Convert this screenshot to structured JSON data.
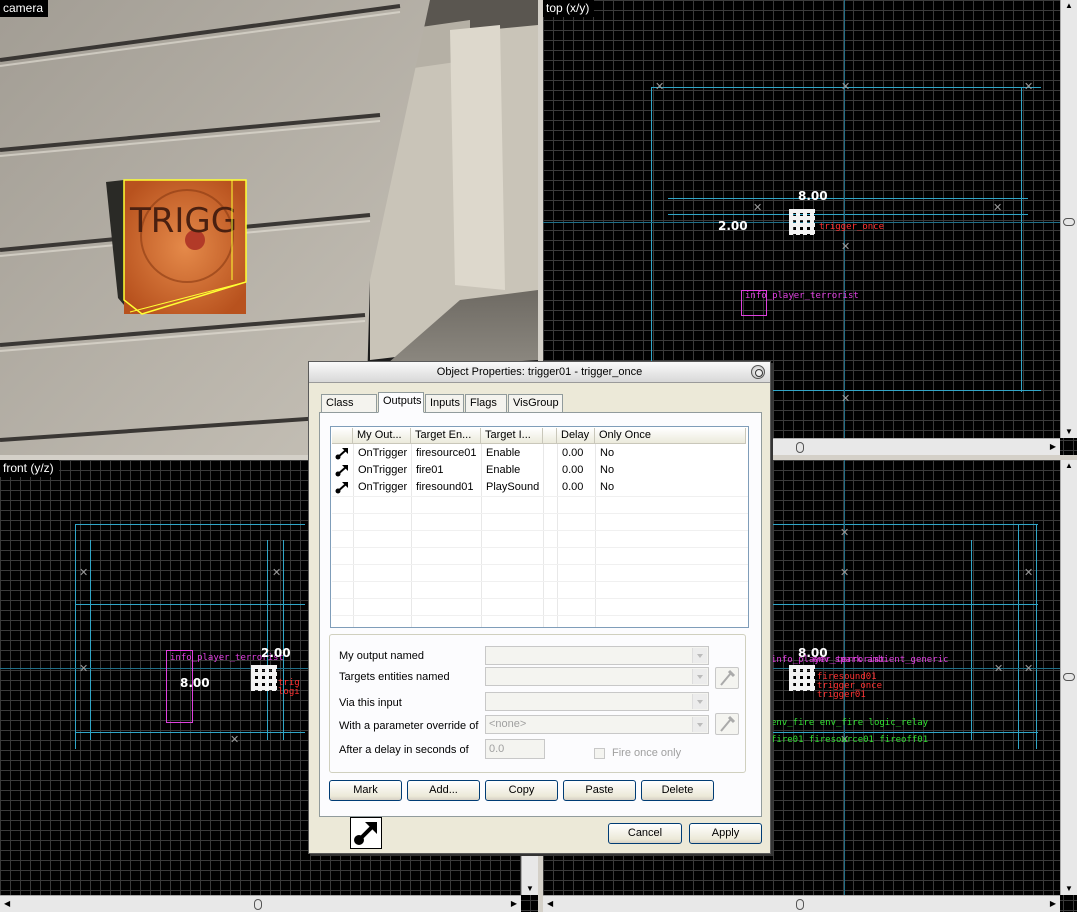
{
  "viewports": {
    "camera": {
      "label": "camera",
      "sign_text": "TRIGG"
    },
    "top": {
      "label": "top (x/y)",
      "dim_w": "8.00",
      "dim_h": "2.00",
      "ent_label_1": "trigger_once",
      "ent_label_2": "info_player_terrorist"
    },
    "front": {
      "label": "front (y/z)",
      "dim_w": "2.00",
      "dim_h": "8.00",
      "ent_label_1": "info_player_terrorist",
      "ent_label_2": "trig",
      "ent_label_3": "logi"
    },
    "side": {
      "label": "",
      "dim_w": "8.00",
      "ent_label_1": "info_player_terrorist",
      "ent_label_2": "env_spark ambient_generic",
      "ent_label_3": "firesound01",
      "ent_label_4": "trigger_once",
      "ent_label_5": "trigger01",
      "ent_label_6": "env_fire env_fire logic_relay",
      "ent_label_7": "fire01 firesource01 fireoff01"
    }
  },
  "dialog": {
    "title": "Object Properties: trigger01 - trigger_once",
    "tabs": [
      {
        "label": "Class Info",
        "active": false
      },
      {
        "label": "Outputs",
        "active": true
      },
      {
        "label": "Inputs",
        "active": false
      },
      {
        "label": "Flags",
        "active": false
      },
      {
        "label": "VisGroup",
        "active": false
      }
    ],
    "table": {
      "headers": [
        "My Out...",
        "Target En...",
        "Target I...",
        "Delay",
        "Only Once"
      ],
      "rows": [
        {
          "output": "OnTrigger",
          "target": "firesource01",
          "input": "Enable",
          "delay": "0.00",
          "once": "No"
        },
        {
          "output": "OnTrigger",
          "target": "fire01",
          "input": "Enable",
          "delay": "0.00",
          "once": "No"
        },
        {
          "output": "OnTrigger",
          "target": "firesound01",
          "input": "PlaySound",
          "delay": "0.00",
          "once": "No"
        }
      ]
    },
    "form": {
      "output_label": "My output named",
      "targets_label": "Targets entities named",
      "input_label": "Via this input",
      "param_label": "With a parameter override of",
      "param_value": "<none>",
      "delay_label": "After a delay in seconds of",
      "delay_value": "0.0",
      "fire_once_label": "Fire once only"
    },
    "buttons": {
      "mark": "Mark",
      "add": "Add...",
      "copy": "Copy",
      "paste": "Paste",
      "delete": "Delete",
      "cancel": "Cancel",
      "apply": "Apply"
    }
  },
  "colors": {
    "grid_line": "#2fa6c8",
    "entity": "#e040e0",
    "selection": "#ff3030",
    "logic": "#30e030",
    "bg": "#000000"
  }
}
